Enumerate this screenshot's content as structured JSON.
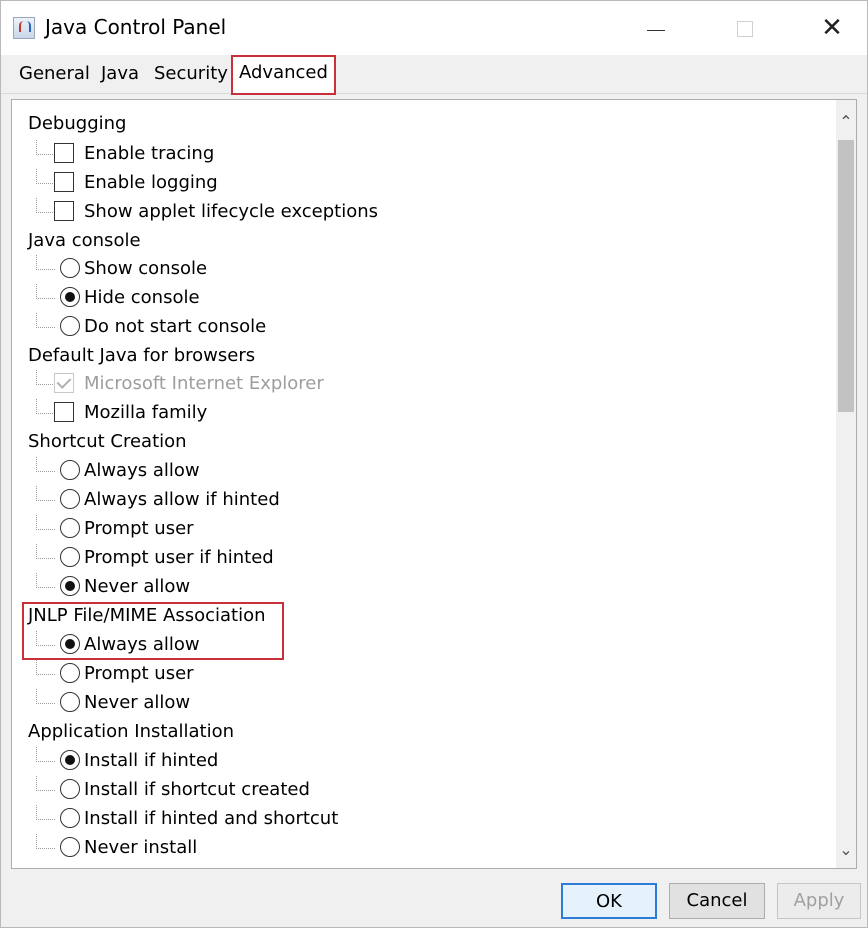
{
  "window": {
    "title": "Java Control Panel"
  },
  "tabs": [
    {
      "label": "General"
    },
    {
      "label": "Java"
    },
    {
      "label": "Security"
    },
    {
      "label": "Advanced",
      "active": true
    }
  ],
  "tree": {
    "debugging": {
      "label": "Debugging",
      "items": [
        {
          "label": "Enable tracing",
          "checked": false
        },
        {
          "label": "Enable logging",
          "checked": false
        },
        {
          "label": "Show applet lifecycle exceptions",
          "checked": false
        }
      ]
    },
    "java_console": {
      "label": "Java console",
      "items": [
        {
          "label": "Show console",
          "selected": false
        },
        {
          "label": "Hide console",
          "selected": true
        },
        {
          "label": "Do not start console",
          "selected": false
        }
      ]
    },
    "default_java": {
      "label": "Default Java for browsers",
      "items": [
        {
          "label": "Microsoft Internet Explorer",
          "checked": true,
          "disabled": true
        },
        {
          "label": "Mozilla family",
          "checked": false
        }
      ]
    },
    "shortcut_creation": {
      "label": "Shortcut Creation",
      "items": [
        {
          "label": "Always allow",
          "selected": false
        },
        {
          "label": "Always allow if hinted",
          "selected": false
        },
        {
          "label": "Prompt user",
          "selected": false
        },
        {
          "label": "Prompt user if hinted",
          "selected": false
        },
        {
          "label": "Never allow",
          "selected": true
        }
      ]
    },
    "jnlp": {
      "label": "JNLP File/MIME Association",
      "items": [
        {
          "label": "Always allow",
          "selected": true
        },
        {
          "label": "Prompt user",
          "selected": false
        },
        {
          "label": "Never allow",
          "selected": false
        }
      ]
    },
    "app_install": {
      "label": "Application Installation",
      "items": [
        {
          "label": "Install if hinted",
          "selected": true
        },
        {
          "label": "Install if shortcut created",
          "selected": false
        },
        {
          "label": "Install if hinted and shortcut",
          "selected": false
        },
        {
          "label": "Never install",
          "selected": false
        }
      ]
    }
  },
  "buttons": {
    "ok": "OK",
    "cancel": "Cancel",
    "apply": "Apply"
  },
  "colors": {
    "highlight": "#c8313a",
    "default_button": "#2f7bd8"
  }
}
